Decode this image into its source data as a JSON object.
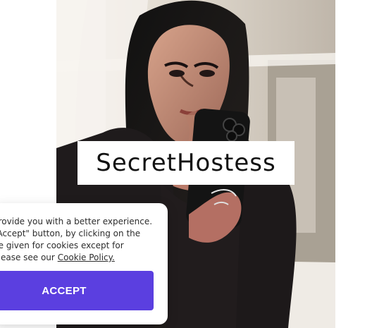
{
  "site": {
    "logo_text": "SecretHostess"
  },
  "cookie_banner": {
    "lines": [
      "provide you with a better experience.",
      "\"Accept\" button, by clicking on the",
      "be given for cookies except for",
      "please see our"
    ],
    "policy_link": "Cookie Policy.",
    "accept_label": "ACCEPT"
  },
  "colors": {
    "accent": "#5b3fe0",
    "background": "#ffffff"
  },
  "icons": {
    "photo": "profile-photo"
  }
}
